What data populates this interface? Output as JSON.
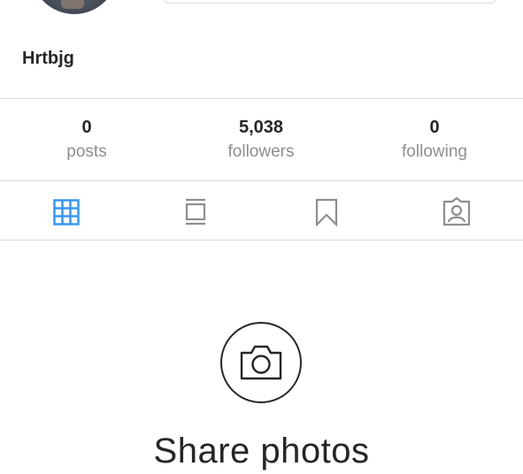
{
  "profile": {
    "username": "Hrtbjg"
  },
  "stats": [
    {
      "count": "0",
      "label": "posts"
    },
    {
      "count": "5,038",
      "label": "followers"
    },
    {
      "count": "0",
      "label": "following"
    }
  ],
  "tabs": [
    {
      "icon": "grid-icon",
      "active": true
    },
    {
      "icon": "feed-icon",
      "active": false
    },
    {
      "icon": "bookmark-icon",
      "active": false
    },
    {
      "icon": "tagged-icon",
      "active": false
    }
  ],
  "empty_state": {
    "icon": "camera-icon",
    "title": "Share photos"
  },
  "colors": {
    "active_tab": "#3897f0",
    "inactive_tab": "#8e8e8e",
    "text": "#262626",
    "muted": "#8e8e8e",
    "divider": "#dbdbdb"
  }
}
